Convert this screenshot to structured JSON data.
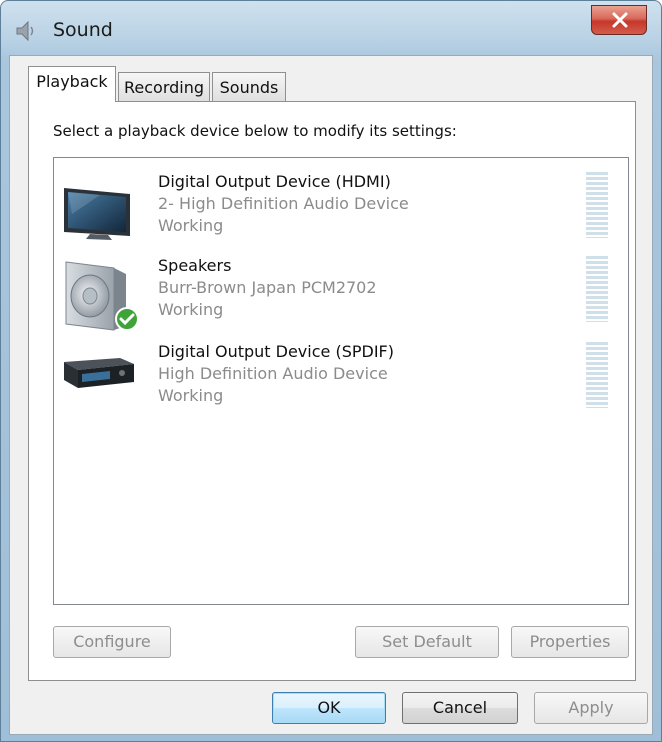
{
  "window": {
    "title": "Sound"
  },
  "tabs": [
    {
      "label": "Playback",
      "active": true
    },
    {
      "label": "Recording",
      "active": false
    },
    {
      "label": "Sounds",
      "active": false
    }
  ],
  "instruction": "Select a playback device below to modify its settings:",
  "devices": [
    {
      "name": "Digital Output Device (HDMI)",
      "description": "2- High Definition Audio Device",
      "status": "Working",
      "icon": "monitor-icon",
      "default": false
    },
    {
      "name": "Speakers",
      "description": "Burr-Brown Japan PCM2702",
      "status": "Working",
      "icon": "speaker-icon",
      "default": true
    },
    {
      "name": "Digital Output Device (SPDIF)",
      "description": "High Definition Audio Device",
      "status": "Working",
      "icon": "receiver-icon",
      "default": false
    }
  ],
  "buttons": {
    "configure": "Configure",
    "set_default": "Set Default",
    "properties": "Properties",
    "ok": "OK",
    "cancel": "Cancel",
    "apply": "Apply"
  },
  "colors": {
    "title_bar": "#b8d1e4",
    "close_button": "#c6372a",
    "default_button": "#3c7fb1",
    "check_badge": "#3fa33a"
  }
}
